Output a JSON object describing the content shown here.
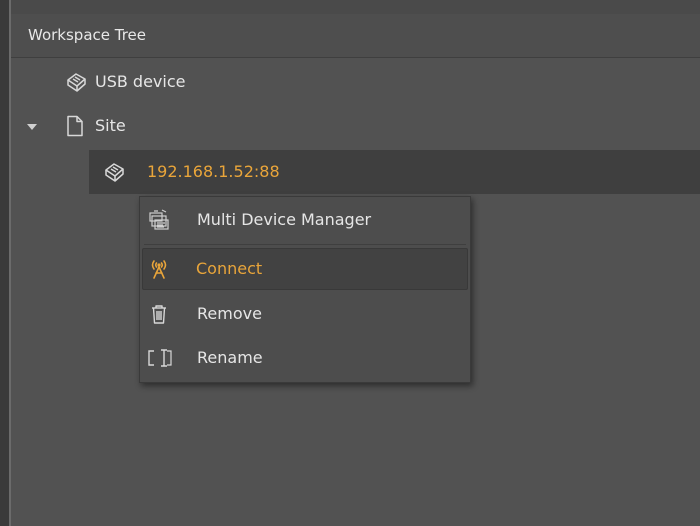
{
  "panel": {
    "title": "Workspace Tree"
  },
  "tree": {
    "items": [
      {
        "label": "USB device",
        "icon": "device-icon"
      },
      {
        "label": "Site",
        "icon": "page-icon",
        "expanded": true
      },
      {
        "label": "192.168.1.52:88",
        "icon": "device-icon",
        "selected": true
      }
    ]
  },
  "context_menu": {
    "items": [
      {
        "label": "Multi Device Manager",
        "icon": "multi-device-icon"
      },
      {
        "label": "Connect",
        "icon": "antenna-icon",
        "highlighted": true
      },
      {
        "label": "Remove",
        "icon": "trash-icon"
      },
      {
        "label": "Rename",
        "icon": "rename-icon"
      }
    ]
  },
  "colors": {
    "accent": "#e9a53a",
    "background": "#505050",
    "selected_row": "#3f3f3f"
  }
}
